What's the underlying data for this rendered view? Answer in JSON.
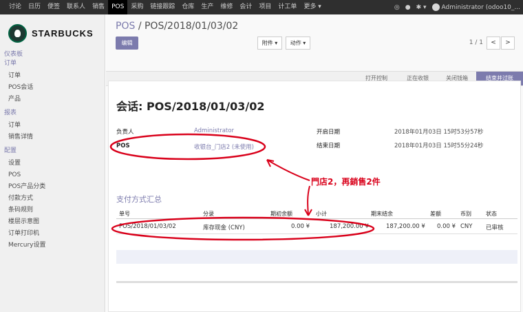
{
  "topbar": {
    "menu": [
      "讨论",
      "日历",
      "便签",
      "联系人",
      "销售",
      "POS",
      "采购",
      "链接跟踪",
      "仓库",
      "生产",
      "维修",
      "会计",
      "项目",
      "计工单",
      "更多 ▾"
    ],
    "user": "Administrator (odoo10_..."
  },
  "brand": "STARBUCKS",
  "sidebar": {
    "s1": "仪表板",
    "s2": "订单",
    "items1": [
      "订单",
      "POS会话",
      "产品"
    ],
    "s3": "报表",
    "items2": [
      "订单",
      "销售详情"
    ],
    "s4": "配置",
    "items3": [
      "设置",
      "POS",
      "POS产品分类",
      "付款方式",
      "条码规则",
      "楼层示意图",
      "订单打印机",
      "Mercury设置"
    ]
  },
  "breadcrumb": {
    "root": "POS",
    "sep": "/",
    "current": "POS/2018/01/03/02"
  },
  "toolbar": {
    "edit": "编辑",
    "attach": "附件 ▾",
    "action": "动作 ▾",
    "pager": "1 / 1",
    "prev": "<",
    "next": ">"
  },
  "stages": [
    "打开控制",
    "正在收银",
    "关闭钱箱",
    "结束并过账"
  ],
  "form": {
    "title": "会话: POS/2018/01/03/02",
    "responsible_label": "负责人",
    "responsible": "Administrator",
    "pos_label": "POS",
    "pos": "收银台_门店2 (未使用)",
    "open_label": "开启日期",
    "open": "2018年01月03日 15时53分57秒",
    "close_label": "结束日期",
    "close": "2018年01月03日 15时55分24秒"
  },
  "payments": {
    "title": "支付方式汇总",
    "headers": [
      "单号",
      "分录",
      "期初余额",
      "小计",
      "期末结余",
      "差额",
      "币别",
      "状态"
    ],
    "row": [
      "POS/2018/01/03/02",
      "库存现金 (CNY)",
      "0.00 ¥",
      "187,200.00 ¥",
      "187,200.00 ¥",
      "0.00 ¥",
      "CNY",
      "已审核"
    ]
  },
  "annotation": "門店2，再銷售2件",
  "colors": {
    "accent": "#7c7bad",
    "annotation": "#d9001a",
    "topbar": "#2f2f2f"
  }
}
